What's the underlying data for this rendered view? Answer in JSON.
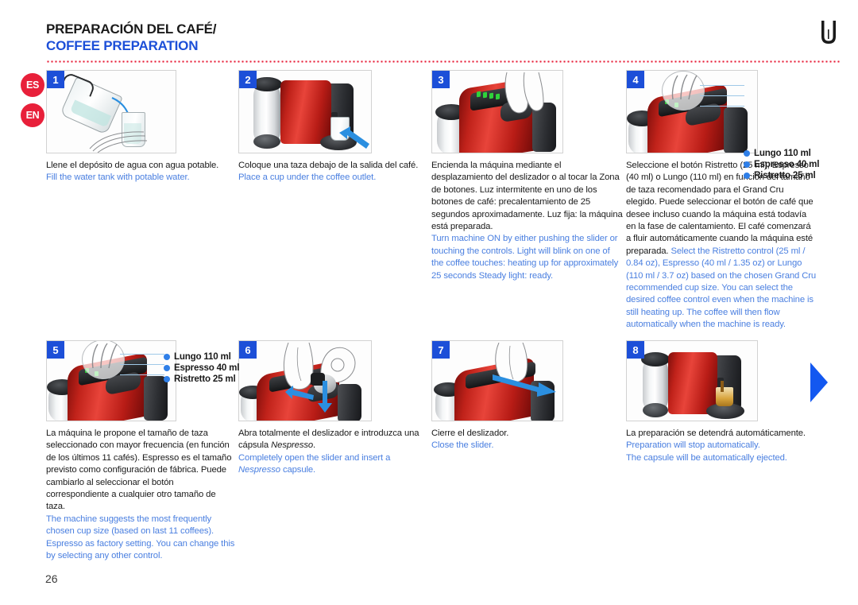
{
  "header": {
    "title_es": "PREPARACIÓN DEL CAFÉ/",
    "title_en": "COFFEE PREPARATION",
    "logo_mark": "U"
  },
  "languages": [
    {
      "code": "ES"
    },
    {
      "code": "EN"
    }
  ],
  "callout_labels": {
    "lungo": "Lungo 110 ml",
    "espresso": "Espresso 40 ml",
    "ristretto": "Ristretto 25 ml"
  },
  "steps": [
    {
      "number": "1",
      "image_name": "filling-water-tank-illustration",
      "es": "Llene el depósito de agua con agua potable.",
      "en": "Fill the water tank with potable water."
    },
    {
      "number": "2",
      "image_name": "cup-under-coffee-outlet-photo",
      "es": "Coloque una taza debajo de la salida del café.",
      "en": "Place a cup under the coffee outlet."
    },
    {
      "number": "3",
      "image_name": "turn-machine-on-photo",
      "es": "Encienda la máquina mediante el desplazamiento del deslizador o al tocar la Zona de botones. Luz intermitente en uno de los botones de café: precalentamiento de 25 segundos aproximadamente. Luz fija: la máquina está preparada.",
      "en": "Turn machine ON by either pushing the slider or touching the controls. Light will blink on one of the coffee touches: heating up for approximately 25 seconds Steady light: ready."
    },
    {
      "number": "4",
      "image_name": "select-coffee-control-photo",
      "es": "Seleccione el botón Ristretto (25 ml), Espresso (40 ml) o Lungo (110 ml) en función del tamaño de taza recomendado para el Grand Cru elegido. Puede seleccionar el botón de café que desee incluso cuando la máquina está todavía en la fase de calentamiento. El café comenzará a fluir automáticamente cuando la máquina esté preparada.",
      "en": "Select the Ristretto control (25 ml / 0.84 oz), Espresso (40 ml / 1.35 oz) or Lungo (110 ml / 3.7 oz) based on the chosen Grand Cru recommended cup size. You can select the desired coffee control even when the machine is still heating up. The coffee will then flow automatically when the machine is ready.",
      "has_callout": true
    },
    {
      "number": "5",
      "image_name": "suggested-cup-size-photo",
      "es": "La máquina le propone el tamaño de taza seleccionado con mayor frecuencia (en función de los últimos 11 cafés). Espresso es el tamaño previsto como configuración de fábrica. Puede cambiarlo al seleccionar el botón correspondiente a cualquier otro tamaño de taza.",
      "en": "The machine suggests the most frequently chosen cup size (based on last 11 coffees). Espresso as factory setting. You can change this by selecting any other control.",
      "has_callout": true
    },
    {
      "number": "6",
      "image_name": "open-slider-insert-capsule-photo",
      "es_html": "Abra totalmente el deslizador e introduzca una cápsula <em>Nespresso</em>.",
      "en_html": "Completely open the slider and insert a <em>Nespresso</em> capsule."
    },
    {
      "number": "7",
      "image_name": "close-slider-photo",
      "es": "Cierre el deslizador.",
      "en": "Close the slider."
    },
    {
      "number": "8",
      "image_name": "preparation-stops-photo",
      "es": "La preparación se detendrá automáticamente.",
      "en": "Preparation will stop automatically.\nThe capsule will be automatically ejected.",
      "en_line1": "Preparation will stop automatically.",
      "en_line2": "The capsule will be automatically ejected."
    }
  ],
  "page_number": "26",
  "next_arrow_name": "next-page-arrow",
  "colors": {
    "accent_blue": "#1c4fd8",
    "caption_blue": "#4a7fe0",
    "badge_red": "#e8203a",
    "arrow_blue": "#1358f0"
  }
}
